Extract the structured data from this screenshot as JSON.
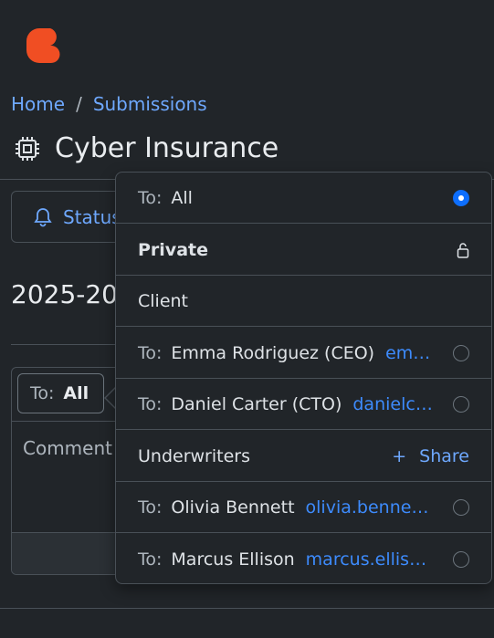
{
  "app": {
    "brand_color": "#f04e23"
  },
  "breadcrumb": {
    "home": "Home",
    "separator": "/",
    "current": "Submissions"
  },
  "page": {
    "title": "Cyber Insurance",
    "title_icon": "cpu-icon"
  },
  "status_button": {
    "label": "Status"
  },
  "date_heading": "2025-20",
  "comment_card": {
    "to_label": "To:",
    "to_value": "All",
    "placeholder": "Comment"
  },
  "bottom": {
    "text": ""
  },
  "popover": {
    "all_row": {
      "to": "To:",
      "value": "All",
      "selected": true
    },
    "private_header": {
      "label": "Private",
      "icon": "lock-icon"
    },
    "client_header": {
      "label": "Client"
    },
    "client_recipients": [
      {
        "to": "To:",
        "name": "Emma Rodriguez (CEO)",
        "email": "em…"
      },
      {
        "to": "To:",
        "name": "Daniel Carter (CTO)",
        "email": "danielc…"
      }
    ],
    "underwriters_header": {
      "label": "Underwriters",
      "share_label": "Share"
    },
    "underwriter_recipients": [
      {
        "to": "To:",
        "name": "Olivia Bennett",
        "email": "olivia.benne…"
      },
      {
        "to": "To:",
        "name": "Marcus Ellison",
        "email": "marcus.ellis…"
      }
    ]
  }
}
